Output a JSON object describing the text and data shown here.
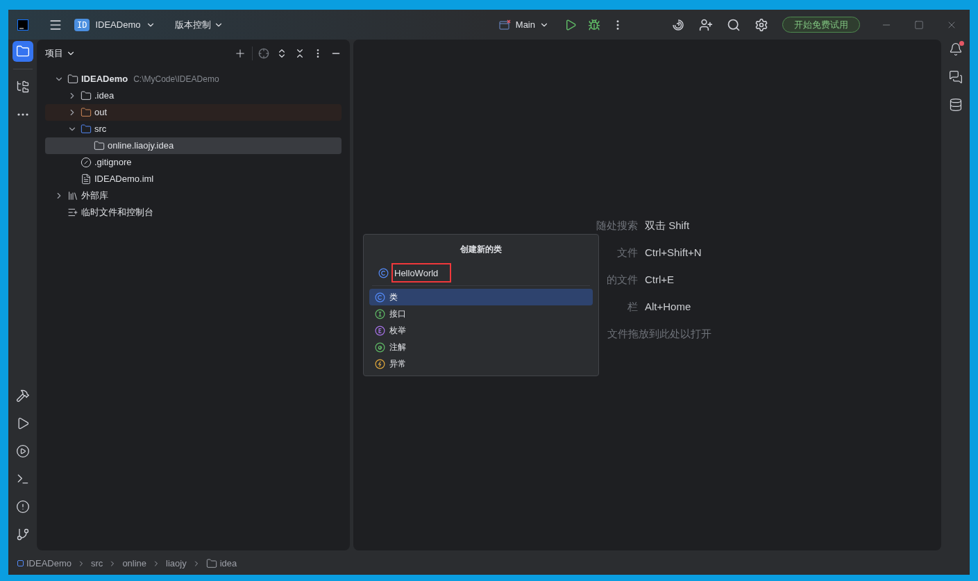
{
  "toolbar": {
    "project": {
      "badge": "ID",
      "name": "IDEADemo"
    },
    "vcs": "版本控制",
    "run_config": "Main",
    "trial_button": "开始免费试用"
  },
  "left_strip": [
    {
      "kind": "project",
      "selected": true
    },
    {
      "kind": "structure",
      "selected": false
    },
    {
      "kind": "more",
      "selected": false
    }
  ],
  "left_strip_bottom": [
    {
      "kind": "build"
    },
    {
      "kind": "run"
    },
    {
      "kind": "services"
    },
    {
      "kind": "terminal"
    },
    {
      "kind": "problems"
    },
    {
      "kind": "git"
    }
  ],
  "project_panel": {
    "title": "项目",
    "tree": [
      {
        "label": "IDEADemo",
        "path": "C:\\MyCode\\IDEADemo",
        "kind": "project",
        "expanded": true,
        "selected": false,
        "children": [
          {
            "label": ".idea",
            "kind": "folder",
            "expanded": false,
            "selected": false
          },
          {
            "label": "out",
            "kind": "excluded",
            "expanded": false,
            "selected": false
          },
          {
            "label": "src",
            "kind": "source",
            "expanded": true,
            "selected": false,
            "children": [
              {
                "label": "online.liaojy.idea",
                "kind": "package",
                "selected": true
              }
            ]
          },
          {
            "label": ".gitignore",
            "kind": "ignore",
            "selected": false
          },
          {
            "label": "IDEADemo.iml",
            "kind": "file",
            "selected": false
          }
        ]
      },
      {
        "label": "外部库",
        "kind": "library",
        "expanded": false,
        "selected": false
      },
      {
        "label": "临时文件和控制台",
        "kind": "scratch",
        "selected": false
      }
    ]
  },
  "editor_hints": [
    {
      "label": "随处搜索",
      "keys": "双击 Shift"
    },
    {
      "label": "文件",
      "keys": "Ctrl+Shift+N"
    },
    {
      "label": "的文件",
      "keys": "Ctrl+E"
    },
    {
      "label": "栏",
      "keys": "Alt+Home"
    },
    {
      "label": "文件拖放到此处以打开"
    }
  ],
  "new_class_dialog": {
    "title": "创建新的类",
    "value": "HelloWorld",
    "options": [
      {
        "label": "类",
        "kind": "class",
        "selected": true
      },
      {
        "label": "接口",
        "kind": "interface",
        "selected": false
      },
      {
        "label": "枚举",
        "kind": "enum",
        "selected": false
      },
      {
        "label": "注解",
        "kind": "annotation",
        "selected": false
      },
      {
        "label": "异常",
        "kind": "exception",
        "selected": false
      }
    ]
  },
  "right_strip": [
    {
      "kind": "notifications",
      "unread": true
    },
    {
      "kind": "ai-chat"
    },
    {
      "kind": "database"
    }
  ],
  "breadcrumbs": [
    {
      "label": "IDEADemo",
      "kind": "module"
    },
    {
      "label": "src",
      "kind": "plain"
    },
    {
      "label": "online",
      "kind": "plain"
    },
    {
      "label": "liaojy",
      "kind": "plain"
    },
    {
      "label": "idea",
      "kind": "package"
    }
  ]
}
